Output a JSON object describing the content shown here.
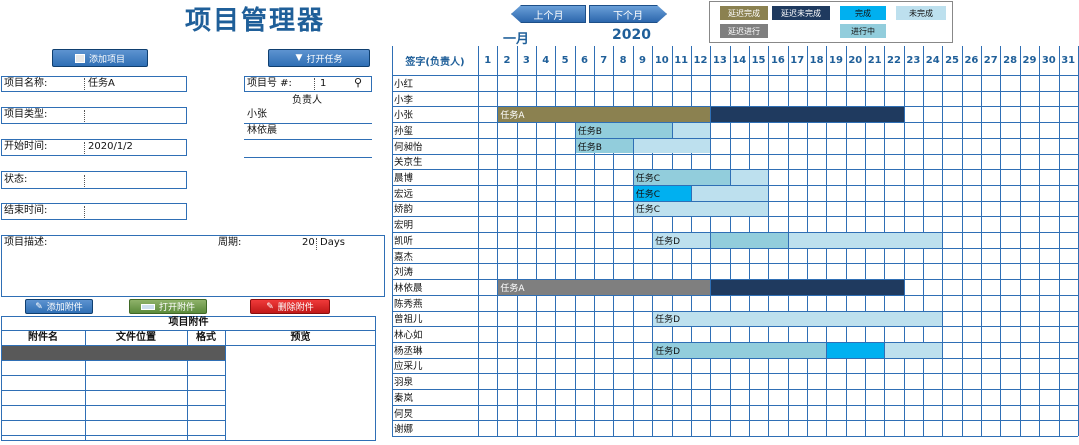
{
  "app": {
    "title": "项目管理器"
  },
  "toolbar": {
    "add_project": "添加项目",
    "open_task": "打开任务"
  },
  "nav": {
    "prev": "上个月",
    "next": "下个月",
    "month": "一月",
    "year": "2020"
  },
  "legend": {
    "items": [
      {
        "label": "延迟完成",
        "bg": "#8b8150",
        "fg": "#ffffff"
      },
      {
        "label": "延迟未完成",
        "bg": "#1f3a5f",
        "fg": "#ffffff"
      },
      {
        "label": "完成",
        "bg": "#00b0f0",
        "fg": "#111111"
      },
      {
        "label": "未完成",
        "bg": "#bde0ee",
        "fg": "#111111"
      },
      {
        "label": "延迟进行",
        "bg": "#7f7f7f",
        "fg": "#ffffff"
      },
      {
        "label": "进行中",
        "bg": "#92cddc",
        "fg": "#111111"
      }
    ]
  },
  "form": {
    "project_name_label": "项目名称:",
    "project_name": "任务A",
    "project_no_label": "项目号 #:",
    "project_no": "1",
    "owner_label": "负责人",
    "owners": [
      "小张",
      "林依晨"
    ],
    "type_label": "项目类型:",
    "start_label": "开始时间:",
    "start": "2020/1/2",
    "status_label": "状态:",
    "end_label": "结束时间:",
    "desc_label": "项目描述:",
    "period_label": "周期:",
    "period": "20",
    "period_unit": "Days"
  },
  "attachments": {
    "add": "添加附件",
    "open": "打开附件",
    "delete": "删除附件",
    "title": "项目附件",
    "columns": [
      "附件名",
      "文件位置",
      "格式",
      "预览"
    ]
  },
  "gantt": {
    "header": "签字(负责人)",
    "days": [
      "1",
      "2",
      "3",
      "4",
      "5",
      "6",
      "7",
      "8",
      "9",
      "10",
      "11",
      "12",
      "13",
      "14",
      "15",
      "16",
      "17",
      "18",
      "19",
      "20",
      "21",
      "22",
      "23",
      "24",
      "25",
      "26",
      "27",
      "28",
      "29",
      "30",
      "31"
    ],
    "people": [
      "小红",
      "小李",
      "小张",
      "孙玺",
      "何昶怡",
      "关京生",
      "晨博",
      "宏远",
      "娇韵",
      "宏明",
      "凯听",
      "嘉杰",
      "刘涛",
      "林依晨",
      "陈秀燕",
      "曾祖儿",
      "林心如",
      "杨丞琳",
      "应采儿",
      "羽泉",
      "秦岚",
      "何炅",
      "谢娜"
    ],
    "bars": [
      {
        "row": 2,
        "start": 1,
        "len": 11,
        "color": "#8b8150",
        "label": "任务A",
        "fg": "#ffffff"
      },
      {
        "row": 2,
        "start": 12,
        "len": 10,
        "color": "#1f3a5f",
        "label": "",
        "fg": "#ffffff"
      },
      {
        "row": 3,
        "start": 5,
        "len": 5,
        "color": "#92cddc",
        "label": "任务B",
        "fg": "#111111"
      },
      {
        "row": 3,
        "start": 10,
        "len": 2,
        "color": "#bde0ee",
        "label": "",
        "fg": "#111111"
      },
      {
        "row": 4,
        "start": 5,
        "len": 3,
        "color": "#92cddc",
        "label": "任务B",
        "fg": "#111111"
      },
      {
        "row": 4,
        "start": 8,
        "len": 4,
        "color": "#bde0ee",
        "label": "",
        "fg": "#111111"
      },
      {
        "row": 6,
        "start": 8,
        "len": 5,
        "color": "#92cddc",
        "label": "任务C",
        "fg": "#111111"
      },
      {
        "row": 6,
        "start": 13,
        "len": 2,
        "color": "#bde0ee",
        "label": "",
        "fg": "#111111"
      },
      {
        "row": 7,
        "start": 8,
        "len": 3,
        "color": "#00b0f0",
        "label": "任务C",
        "fg": "#111111"
      },
      {
        "row": 7,
        "start": 11,
        "len": 4,
        "color": "#bde0ee",
        "label": "",
        "fg": "#111111"
      },
      {
        "row": 8,
        "start": 8,
        "len": 7,
        "color": "#bde0ee",
        "label": "任务C",
        "fg": "#111111"
      },
      {
        "row": 10,
        "start": 9,
        "len": 3,
        "color": "#bde0ee",
        "label": "任务D",
        "fg": "#111111"
      },
      {
        "row": 10,
        "start": 12,
        "len": 4,
        "color": "#92cddc",
        "label": "",
        "fg": "#111111"
      },
      {
        "row": 10,
        "start": 16,
        "len": 8,
        "color": "#bde0ee",
        "label": "",
        "fg": "#111111"
      },
      {
        "row": 13,
        "start": 1,
        "len": 11,
        "color": "#7f7f7f",
        "label": "任务A",
        "fg": "#ffffff"
      },
      {
        "row": 13,
        "start": 12,
        "len": 10,
        "color": "#1f3a5f",
        "label": "",
        "fg": "#ffffff"
      },
      {
        "row": 15,
        "start": 9,
        "len": 15,
        "color": "#bde0ee",
        "label": "任务D",
        "fg": "#111111"
      },
      {
        "row": 17,
        "start": 9,
        "len": 9,
        "color": "#92cddc",
        "label": "任务D",
        "fg": "#111111"
      },
      {
        "row": 17,
        "start": 18,
        "len": 3,
        "color": "#00b0f0",
        "label": "",
        "fg": "#111111"
      },
      {
        "row": 17,
        "start": 21,
        "len": 3,
        "color": "#bde0ee",
        "label": "",
        "fg": "#111111"
      }
    ]
  }
}
